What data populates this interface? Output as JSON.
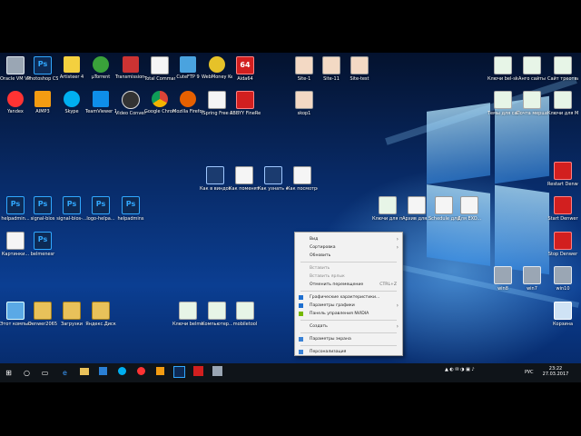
{
  "colors": {
    "accent": "#0a64c8",
    "taskbar": "#0f1419",
    "menu_bg": "#f2f2f2"
  },
  "desktop": {
    "icons": [
      {
        "label": "Oracle VM VirtualBox",
        "icon": "virtualbox-icon"
      },
      {
        "label": "Photoshop CS6 x64",
        "icon": "photoshop-icon"
      },
      {
        "label": "Artisteer 4",
        "icon": "artisteer-icon"
      },
      {
        "label": "µTorrent",
        "icon": "utorrent-icon"
      },
      {
        "label": "Transmission Remote GUI",
        "icon": "transmission-icon"
      },
      {
        "label": "Total Commander",
        "icon": "total-commander-icon"
      },
      {
        "label": "CuteFTP 9",
        "icon": "cuteftp-icon"
      },
      {
        "label": "WebMoney Keeper W...",
        "icon": "webmoney-icon"
      },
      {
        "label": "Aida64",
        "icon": "aida64-icon"
      },
      {
        "label": "Yandex",
        "icon": "yandex-icon"
      },
      {
        "label": "AIMP3",
        "icon": "aimp-icon"
      },
      {
        "label": "Skype",
        "icon": "skype-icon"
      },
      {
        "label": "TeamViewer 12",
        "icon": "teamviewer-icon"
      },
      {
        "label": "Video Convert...",
        "icon": "video-converter-icon"
      },
      {
        "label": "Google Chrome",
        "icon": "chrome-icon"
      },
      {
        "label": "Mozilla Firefox",
        "icon": "firefox-icon"
      },
      {
        "label": "iSpring Free Cam 8",
        "icon": "ispring-icon"
      },
      {
        "label": "ABBYY FineReat...",
        "icon": "abbyy-icon"
      },
      {
        "label": "Site-1",
        "icon": "site-icon"
      },
      {
        "label": "Site-11",
        "icon": "site-icon"
      },
      {
        "label": "Site-test",
        "icon": "site-icon"
      },
      {
        "label": "skop1",
        "icon": "site-icon"
      },
      {
        "label": "Ключи bel-skeping",
        "icon": "keys-icon"
      },
      {
        "label": "Анго сайты",
        "icon": "keys-icon"
      },
      {
        "label": "Сайт треотвые",
        "icon": "keys-icon"
      },
      {
        "label": "Темы для сайтов",
        "icon": "keys-icon"
      },
      {
        "label": "Почта мерша",
        "icon": "keys-icon"
      },
      {
        "label": "Ключи для Mobile-stek",
        "icon": "keys-icon"
      },
      {
        "label": "Как в виндовс 1...",
        "icon": "video-file-icon"
      },
      {
        "label": "Как поменять...",
        "icon": "document-icon"
      },
      {
        "label": "Как узнать какой акт...",
        "icon": "video-file-icon"
      },
      {
        "label": "Как посмотрет...",
        "icon": "document-icon"
      },
      {
        "label": "helpadmin...",
        "icon": "photoshop-file-icon"
      },
      {
        "label": "signal-bios",
        "icon": "photoshop-file-icon"
      },
      {
        "label": "signal-bios-...",
        "icon": "photoshop-file-icon"
      },
      {
        "label": "logo-helpa...",
        "icon": "photoshop-file-icon"
      },
      {
        "label": "helpadmins",
        "icon": "photoshop-file-icon"
      },
      {
        "label": "Картинки...",
        "icon": "document-icon"
      },
      {
        "label": "belmenesr",
        "icon": "photoshop-file-icon"
      },
      {
        "label": "Ключи для пользователя",
        "icon": "keys-icon"
      },
      {
        "label": "Архив для...",
        "icon": "document-icon"
      },
      {
        "label": "Schedule для...",
        "icon": "document-icon"
      },
      {
        "label": "Для EXO...",
        "icon": "document-icon"
      },
      {
        "label": "Restart Denwer",
        "icon": "denwer-icon"
      },
      {
        "label": "Start Denwer",
        "icon": "denwer-icon"
      },
      {
        "label": "Stop Denwer",
        "icon": "denwer-icon"
      },
      {
        "label": "win8",
        "icon": "vm-cube-icon"
      },
      {
        "label": "win7",
        "icon": "vm-cube-icon"
      },
      {
        "label": "win10",
        "icon": "vm-cube-icon"
      },
      {
        "label": "Корзина",
        "icon": "recycle-bin-icon"
      },
      {
        "label": "Этот компьютер",
        "icon": "this-pc-icon"
      },
      {
        "label": "Denwer2065",
        "icon": "folder-icon"
      },
      {
        "label": "Загрузки",
        "icon": "folder-icon"
      },
      {
        "label": "Яндекс.Диск",
        "icon": "yandex-disk-icon"
      },
      {
        "label": "Ключи belmenesr...",
        "icon": "keys-icon"
      },
      {
        "label": "Компьютер...",
        "icon": "keys-icon"
      },
      {
        "label": "mobiletool",
        "icon": "keys-icon"
      }
    ]
  },
  "context_menu": {
    "items": [
      {
        "label": "Вид",
        "submenu": true
      },
      {
        "label": "Сортировка",
        "submenu": true
      },
      {
        "label": "Обновить"
      },
      {
        "label": "Вставить",
        "disabled": true
      },
      {
        "label": "Вставить ярлык",
        "disabled": true
      },
      {
        "label": "Отменить перемещение",
        "shortcut": "CTRL+Z"
      },
      {
        "label": "Графические характеристики...",
        "icon": "intel-graphics-icon"
      },
      {
        "label": "Параметры графики",
        "submenu": true,
        "icon": "intel-graphics-icon"
      },
      {
        "label": "Панель управления NVIDIA",
        "icon": "nvidia-icon"
      },
      {
        "label": "Создать",
        "submenu": true
      },
      {
        "label": "Параметры экрана",
        "icon": "display-settings-icon"
      },
      {
        "label": "Персонализация",
        "icon": "personalization-icon"
      }
    ]
  },
  "taskbar": {
    "lang": "РУС",
    "time": "23:22",
    "date": "27.03.2017",
    "pinned": [
      "windows-start-icon",
      "search-icon",
      "task-view-icon",
      "edge-icon",
      "explorer-icon",
      "store-icon",
      "skype-icon",
      "yandex-icon",
      "aimp-icon",
      "photoshop-icon",
      "aida64-icon",
      "virtualbox-icon"
    ]
  }
}
